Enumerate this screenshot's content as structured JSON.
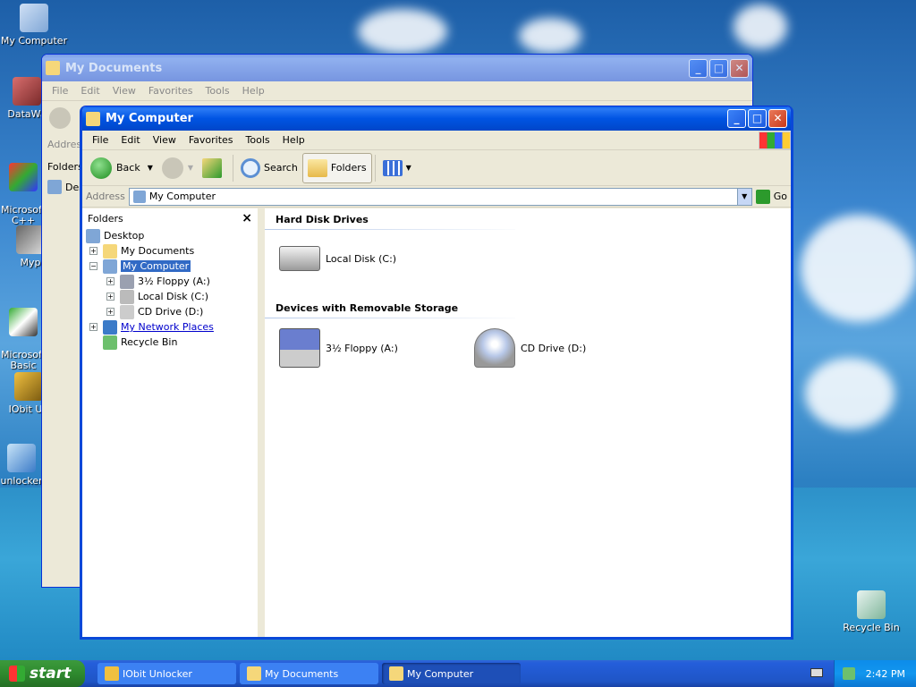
{
  "desktop": {
    "icons": [
      {
        "label": "My Computer"
      },
      {
        "label": "DataWa"
      },
      {
        "label": "Microsoft\nC++"
      },
      {
        "label": "Myp"
      },
      {
        "label": "Microsoft\nBasic"
      },
      {
        "label": "IObit Un"
      },
      {
        "label": "unlocker"
      },
      {
        "label": "Recycle Bin"
      }
    ]
  },
  "back_window": {
    "title": "My Documents",
    "menu": [
      "File",
      "Edit",
      "View",
      "Favorites",
      "Tools",
      "Help"
    ],
    "address_label": "Addres",
    "folders_label": "Folders",
    "tree_first": "Desk"
  },
  "front_window": {
    "title": "My Computer",
    "menu": [
      "File",
      "Edit",
      "View",
      "Favorites",
      "Tools",
      "Help"
    ],
    "toolbar": {
      "back": "Back",
      "search": "Search",
      "folders": "Folders"
    },
    "address": {
      "label": "Address",
      "value": "My Computer",
      "go": "Go"
    },
    "folders_pane": {
      "title": "Folders",
      "close": "×",
      "tree": [
        {
          "label": "Desktop",
          "level": 0,
          "toggle": ""
        },
        {
          "label": "My Documents",
          "level": 1,
          "toggle": "+"
        },
        {
          "label": "My Computer",
          "level": 1,
          "toggle": "−",
          "selected": true
        },
        {
          "label": "3½ Floppy (A:)",
          "level": 2,
          "toggle": "+"
        },
        {
          "label": "Local Disk (C:)",
          "level": 2,
          "toggle": "+"
        },
        {
          "label": "CD Drive (D:)",
          "level": 2,
          "toggle": "+"
        },
        {
          "label": "My Network Places",
          "level": 1,
          "toggle": "+"
        },
        {
          "label": "Recycle Bin",
          "level": 1,
          "toggle": ""
        }
      ]
    },
    "sections": [
      {
        "title": "Hard Disk Drives",
        "items": [
          {
            "label": "Local Disk (C:)",
            "icon": "hard-disk-icon"
          }
        ]
      },
      {
        "title": "Devices with Removable Storage",
        "items": [
          {
            "label": "3½ Floppy (A:)",
            "icon": "floppy-icon"
          },
          {
            "label": "CD Drive (D:)",
            "icon": "cd-drive-icon"
          }
        ]
      }
    ]
  },
  "taskbar": {
    "start": "start",
    "tasks": [
      {
        "label": "IObit Unlocker",
        "active": false
      },
      {
        "label": "My Documents",
        "active": false
      },
      {
        "label": "My Computer",
        "active": true
      }
    ],
    "clock": "2:42 PM"
  }
}
